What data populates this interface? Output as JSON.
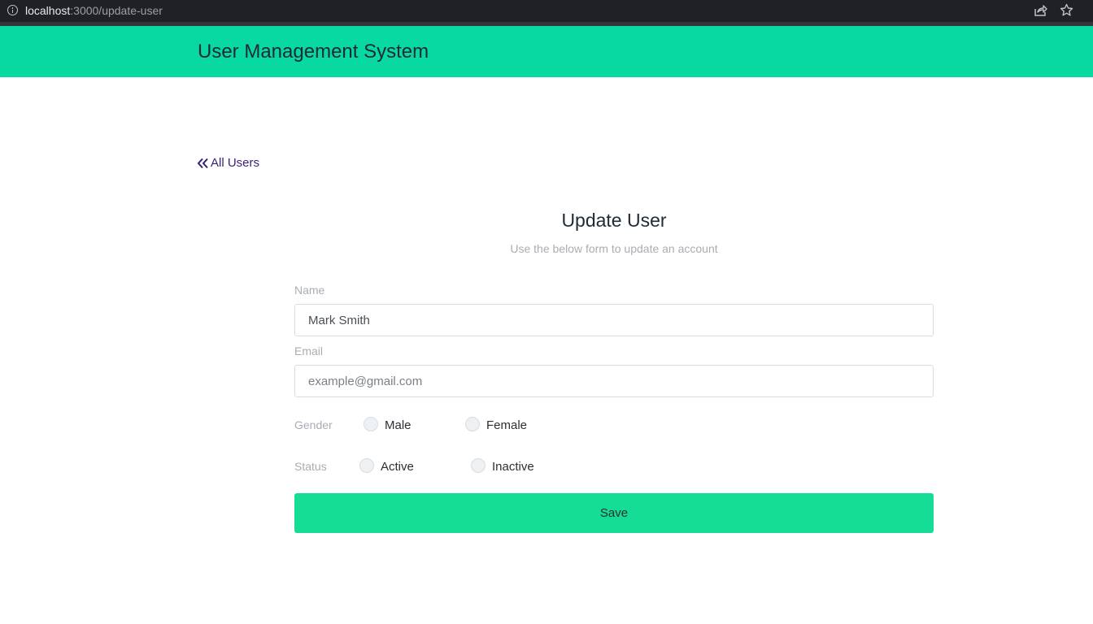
{
  "browser": {
    "url_host": "localhost",
    "url_path": ":3000/update-user"
  },
  "header": {
    "title": "User Management System"
  },
  "back_link": {
    "label": "All Users"
  },
  "form": {
    "title": "Update User",
    "subtitle": "Use the below form to update an account",
    "name": {
      "label": "Name",
      "value": "Mark Smith",
      "placeholder": ""
    },
    "email": {
      "label": "Email",
      "value": "",
      "placeholder": "example@gmail.com"
    },
    "gender": {
      "label": "Gender",
      "options": [
        "Male",
        "Female"
      ]
    },
    "status": {
      "label": "Status",
      "options": [
        "Active",
        "Inactive"
      ]
    },
    "save_label": "Save"
  },
  "colors": {
    "header_bg": "#07d9a0",
    "button_bg": "#15dd95",
    "link": "#3a1e78"
  }
}
